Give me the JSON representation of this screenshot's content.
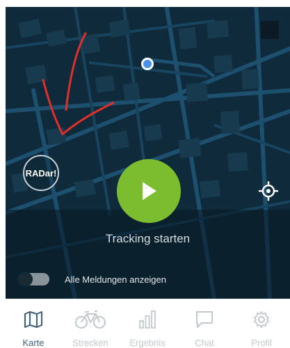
{
  "map": {
    "radar_button_label": "RADar!",
    "play_icon": "play-icon",
    "locate_icon": "crosshair-icon",
    "tracking_label": "Tracking starten",
    "show_all_toggle": {
      "label": "Alle Meldungen anzeigen",
      "checked": false
    }
  },
  "colors": {
    "map_bg": "#0f2a3a",
    "play_button": "#7cbc2f",
    "location_dot": "#4a8fe8",
    "annotation": "#e0302a",
    "nav_active": "#3f5f78",
    "nav_inactive": "#c3c8cc"
  },
  "nav": {
    "items": [
      {
        "label": "Karte",
        "icon": "map-icon",
        "active": true
      },
      {
        "label": "Strecken",
        "icon": "bicycle-icon",
        "active": false
      },
      {
        "label": "Ergebnis",
        "icon": "bar-chart-icon",
        "active": false
      },
      {
        "label": "Chat",
        "icon": "chat-icon",
        "active": false
      },
      {
        "label": "Profil",
        "icon": "gear-icon",
        "active": false
      }
    ]
  }
}
